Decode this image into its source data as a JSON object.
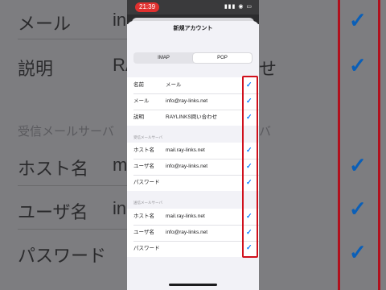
{
  "colors": {
    "accent": "#0a7aff",
    "highlight": "#d0101c",
    "status_time_bg": "#e0302f"
  },
  "status": {
    "time": "21:39",
    "icons": "▮▮▮ ◉ ▭"
  },
  "sheet": {
    "title": "新規アカウント"
  },
  "tabs": [
    {
      "label": "IMAP",
      "selected": false
    },
    {
      "label": "POP",
      "selected": true
    }
  ],
  "account": [
    {
      "label": "名前",
      "value": "メール"
    },
    {
      "label": "メール",
      "value": "info@ray-links.net"
    },
    {
      "label": "説明",
      "value": "RAYLINKS問い合わせ"
    }
  ],
  "incoming": {
    "header": "受信メールサーバ",
    "rows": [
      {
        "label": "ホスト名",
        "value": "mail.ray-links.net"
      },
      {
        "label": "ユーザ名",
        "value": "info@ray-links.net"
      },
      {
        "label": "パスワード",
        "value": ""
      }
    ]
  },
  "outgoing": {
    "header": "送信メールサーバ",
    "rows": [
      {
        "label": "ホスト名",
        "value": "mail.ray-links.net"
      },
      {
        "label": "ユーザ名",
        "value": "info@ray-links.net"
      },
      {
        "label": "パスワード",
        "value": ""
      }
    ]
  },
  "check_mark": "✓",
  "background_zoom": {
    "left": {
      "mail": "メール",
      "desc": "説明",
      "section": "受信メールサーバ",
      "host": "ホスト名",
      "user": "ユーザ名",
      "password": "パスワード"
    },
    "right": {
      "partial": "せ"
    },
    "fragments": {
      "in": "in",
      "ra": "RA",
      "m": "m",
      "ba": "バ"
    }
  }
}
